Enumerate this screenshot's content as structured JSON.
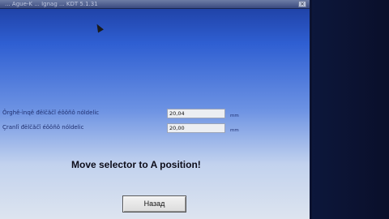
{
  "window": {
    "title": "... Ague-K ... Ignag ... KDT 5.1.31",
    "close_label": "×"
  },
  "fields": [
    {
      "label": "Ôrghê-ìnqê đëlčăčî éôôñô nóldelic",
      "value": "20,04",
      "unit": "mm"
    },
    {
      "label": "Çranlî đëlčăčî éôôñô nóldelic",
      "value": "20,00",
      "unit": "mm"
    }
  ],
  "message": "Move selector to A position!",
  "back_button": {
    "label": "Назад"
  },
  "icons": {
    "cursor": "mouse-pointer-icon"
  }
}
